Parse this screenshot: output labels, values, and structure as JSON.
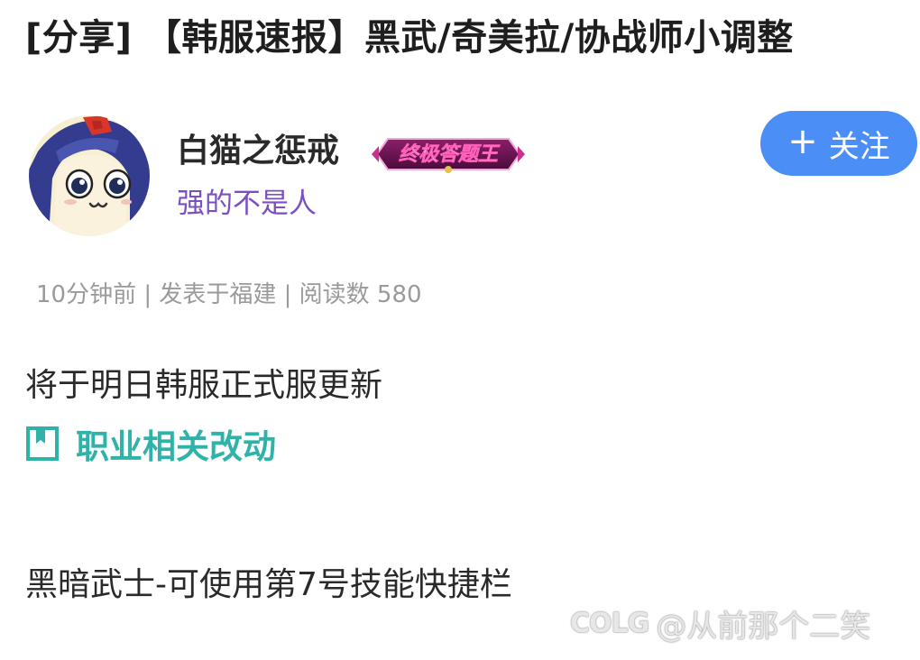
{
  "post": {
    "title": "[分享] 【韩服速报】黑武/奇美拉/协战师小调整"
  },
  "author": {
    "name": "白猫之惩戒",
    "badge_text": "终极答题王",
    "signature": "强的不是人",
    "avatar_icon": "anime-girl-avatar"
  },
  "follow": {
    "plus": "+",
    "label": "关注",
    "color": "#4a8ef6"
  },
  "meta": {
    "text": "10分钟前 | 发表于福建 | 阅读数 580"
  },
  "content": {
    "paragraph1": "将于明日韩服正式服更新",
    "section_label": "职业相关改动",
    "section_icon": "bookmark-icon",
    "paragraph2": "黑暗武士-可使用第7号技能快捷栏"
  },
  "watermark": {
    "logo": "COLG",
    "handle": "@从前那个二笑"
  },
  "colors": {
    "accent_teal": "#2fb3a8",
    "signature_purple": "#7a4fc2",
    "meta_gray": "#9a9a9a"
  }
}
